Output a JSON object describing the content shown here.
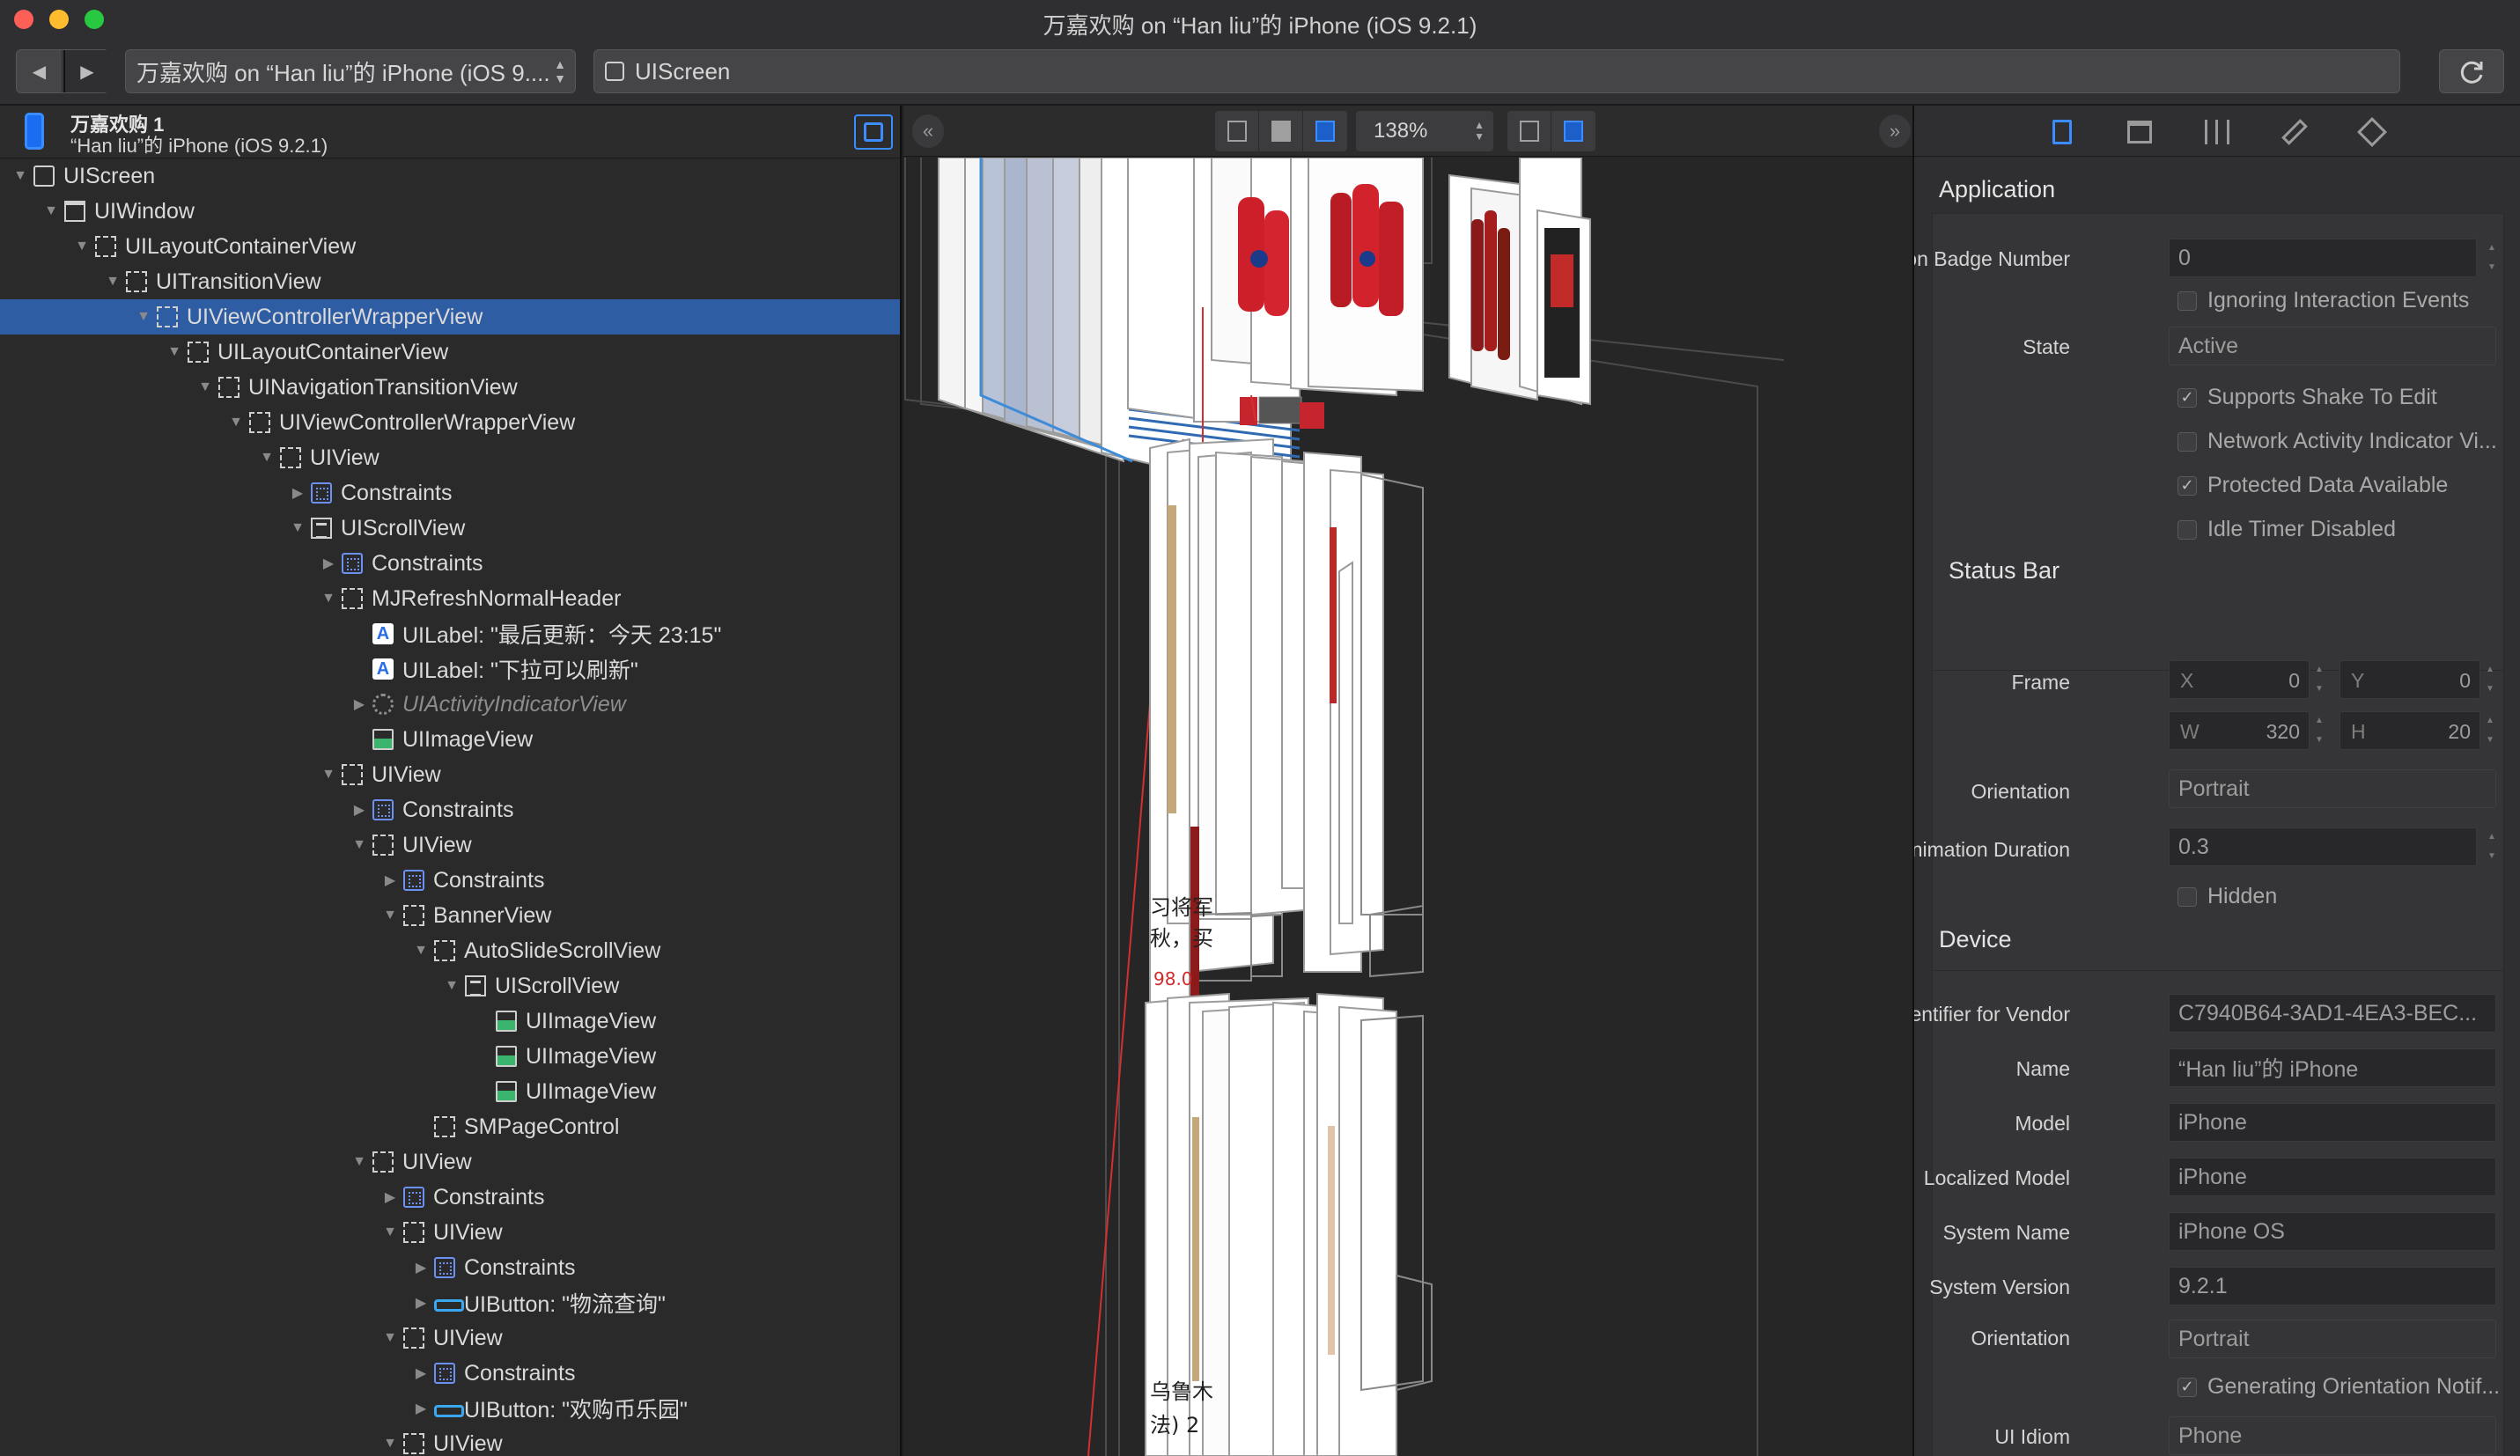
{
  "window": {
    "title": "万嘉欢购 on “Han liu”的 iPhone (iOS 9.2.1)"
  },
  "toolbar": {
    "back_icon": "back-arrow-icon",
    "forward_icon": "forward-arrow-icon",
    "path_popup": "万嘉欢购 on “Han liu”的 iPhone (iOS 9....",
    "scope_label": "UIScreen",
    "refresh_icon": "refresh-icon"
  },
  "device": {
    "app_name": "万嘉欢购 1",
    "device_line": "“Han liu”的 iPhone (iOS 9.2.1)"
  },
  "tree": [
    {
      "label": "UIScreen",
      "depth": 0,
      "icon": "solid",
      "open": true
    },
    {
      "label": "UIWindow",
      "depth": 1,
      "icon": "window",
      "open": true
    },
    {
      "label": "UILayoutContainerView",
      "depth": 2,
      "icon": "dash",
      "open": true
    },
    {
      "label": "UITransitionView",
      "depth": 3,
      "icon": "dash",
      "open": true
    },
    {
      "label": "UIViewControllerWrapperView",
      "depth": 4,
      "icon": "dash",
      "open": true,
      "selected": true
    },
    {
      "label": "UILayoutContainerView",
      "depth": 5,
      "icon": "dash",
      "open": true
    },
    {
      "label": "UINavigationTransitionView",
      "depth": 6,
      "icon": "dash",
      "open": true
    },
    {
      "label": "UIViewControllerWrapperView",
      "depth": 7,
      "icon": "dash",
      "open": true
    },
    {
      "label": "UIView",
      "depth": 8,
      "icon": "dash",
      "open": true
    },
    {
      "label": "Constraints",
      "depth": 9,
      "icon": "constraint",
      "open": false
    },
    {
      "label": "UIScrollView",
      "depth": 9,
      "icon": "scroll",
      "open": true
    },
    {
      "label": "Constraints",
      "depth": 10,
      "icon": "constraint",
      "open": false
    },
    {
      "label": "MJRefreshNormalHeader",
      "depth": 10,
      "icon": "dash",
      "open": true
    },
    {
      "label": "UILabel: \"最后更新：今天 23:15\"",
      "depth": 11,
      "icon": "label",
      "open": null
    },
    {
      "label": "UILabel: \"下拉可以刷新\"",
      "depth": 11,
      "icon": "label",
      "open": null
    },
    {
      "label": "UIActivityIndicatorView",
      "depth": 11,
      "icon": "spinner",
      "open": false,
      "dim": true
    },
    {
      "label": "UIImageView",
      "depth": 11,
      "icon": "image",
      "open": null
    },
    {
      "label": "UIView",
      "depth": 10,
      "icon": "dash",
      "open": true
    },
    {
      "label": "Constraints",
      "depth": 11,
      "icon": "constraint",
      "open": false
    },
    {
      "label": "UIView",
      "depth": 11,
      "icon": "dash",
      "open": true
    },
    {
      "label": "Constraints",
      "depth": 12,
      "icon": "constraint",
      "open": false
    },
    {
      "label": "BannerView",
      "depth": 12,
      "icon": "dash",
      "open": true
    },
    {
      "label": "AutoSlideScrollView",
      "depth": 13,
      "icon": "dash",
      "open": true
    },
    {
      "label": "UIScrollView",
      "depth": 14,
      "icon": "scroll",
      "open": true
    },
    {
      "label": "UIImageView",
      "depth": 15,
      "icon": "image",
      "open": null
    },
    {
      "label": "UIImageView",
      "depth": 15,
      "icon": "image",
      "open": null
    },
    {
      "label": "UIImageView",
      "depth": 15,
      "icon": "image",
      "open": null
    },
    {
      "label": "SMPageControl",
      "depth": 13,
      "icon": "dash",
      "open": null
    },
    {
      "label": "UIView",
      "depth": 11,
      "icon": "dash",
      "open": true
    },
    {
      "label": "Constraints",
      "depth": 12,
      "icon": "constraint",
      "open": false
    },
    {
      "label": "UIView",
      "depth": 12,
      "icon": "dash",
      "open": true
    },
    {
      "label": "Constraints",
      "depth": 13,
      "icon": "constraint",
      "open": false
    },
    {
      "label": "UIButton: \"物流查询\"",
      "depth": 13,
      "icon": "button",
      "open": false
    },
    {
      "label": "UIView",
      "depth": 12,
      "icon": "dash",
      "open": true
    },
    {
      "label": "Constraints",
      "depth": 13,
      "icon": "constraint",
      "open": false
    },
    {
      "label": "UIButton: \"欢购币乐园\"",
      "depth": 13,
      "icon": "button",
      "open": false
    },
    {
      "label": "UIView",
      "depth": 12,
      "icon": "dash",
      "open": true
    }
  ],
  "center": {
    "zoom": "138%",
    "canvas_texts": {
      "t1": "习将军",
      "t2": "秋，买",
      "t3": "98.0",
      "t4": "乌鲁木",
      "t5": "法) 2"
    }
  },
  "inspector": {
    "application": {
      "title": "Application",
      "icon_badge_label": "Icon Badge Number",
      "icon_badge_value": "0",
      "ignoring_label": "Ignoring Interaction Events",
      "ignoring_checked": false,
      "state_label": "State",
      "state_value": "Active",
      "shake_label": "Supports Shake To Edit",
      "shake_checked": true,
      "network_label": "Network Activity Indicator Vi...",
      "network_checked": false,
      "protected_label": "Protected Data Available",
      "protected_checked": true,
      "idle_label": "Idle Timer Disabled",
      "idle_checked": false
    },
    "status_bar": {
      "title": "Status Bar",
      "frame_label": "Frame",
      "x_key": "X",
      "x_val": "0",
      "y_key": "Y",
      "y_val": "0",
      "w_key": "W",
      "w_val": "320",
      "h_key": "H",
      "h_val": "20",
      "orientation_label": "Orientation",
      "orientation_value": "Portrait",
      "anim_label": "Animation Duration",
      "anim_value": "0.3",
      "hidden_label": "Hidden",
      "hidden_checked": false
    },
    "device": {
      "title": "Device",
      "vendor_label": "Identifier for Vendor",
      "vendor_value": "C7940B64-3AD1-4EA3-BEC...",
      "name_label": "Name",
      "name_value": "“Han liu”的 iPhone",
      "model_label": "Model",
      "model_value": "iPhone",
      "lmodel_label": "Localized Model",
      "lmodel_value": "iPhone",
      "sysname_label": "System Name",
      "sysname_value": "iPhone OS",
      "sysver_label": "System Version",
      "sysver_value": "9.2.1",
      "orient_label": "Orientation",
      "orient_value": "Portrait",
      "gen_label": "Generating Orientation Notif...",
      "gen_checked": true,
      "idiom_label": "UI Idiom",
      "idiom_value": "Phone"
    }
  },
  "colors": {
    "selection": "#2f5da3",
    "accent": "#3a8cff"
  }
}
